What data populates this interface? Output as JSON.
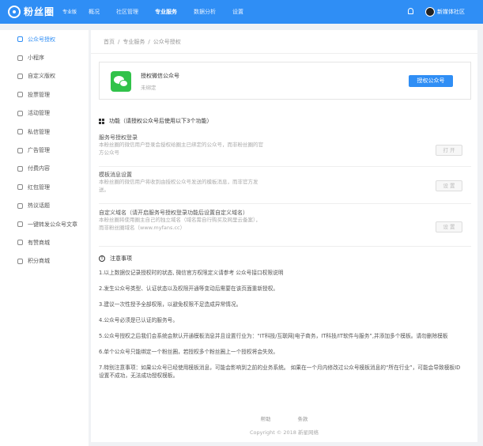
{
  "header": {
    "logo_text": "粉丝圈",
    "edition": "专业版",
    "nav": [
      "概况",
      "社区管理",
      "专业服务",
      "数据分析",
      "设置"
    ],
    "active_nav": 2,
    "user_name": "新媒体社区"
  },
  "sidebar": {
    "items": [
      {
        "label": "公众号授权",
        "icon": "wechat-icon",
        "active": true
      },
      {
        "label": "小程序",
        "icon": "mini-program-icon"
      },
      {
        "label": "自定义版权",
        "icon": "copyright-icon"
      },
      {
        "label": "投票管理",
        "icon": "vote-icon"
      },
      {
        "label": "活动管理",
        "icon": "flag-icon"
      },
      {
        "label": "私信管理",
        "icon": "message-icon"
      },
      {
        "label": "广告管理",
        "icon": "megaphone-icon"
      },
      {
        "label": "付费内容",
        "icon": "paid-icon"
      },
      {
        "label": "红包管理",
        "icon": "red-packet-icon"
      },
      {
        "label": "热议话题",
        "icon": "fire-icon"
      },
      {
        "label": "一键转发公众号文章",
        "icon": "link-icon"
      },
      {
        "label": "有赞商城",
        "icon": "shop-icon"
      },
      {
        "label": "积分商城",
        "icon": "points-icon"
      }
    ]
  },
  "breadcrumb": [
    "首页",
    "专业服务",
    "公众号授权"
  ],
  "card": {
    "title": "授权微信公众号",
    "status": "未绑定",
    "button": "授权公众号"
  },
  "features_heading": "功能（请授权公众号后使用以下3个功能）",
  "features": [
    {
      "title": "服务号授权登录",
      "desc": "本粉丝圈的微信用户登录会授权给圈主已绑定的公众号，而非粉丝圈的官方公众号",
      "button": "打 开"
    },
    {
      "title": "模板消息设置",
      "desc": "本粉丝圈的微信用户将收到由授权公众号发送的模板消息，而非官方发送。",
      "button": "设 置"
    },
    {
      "title": "自定义域名（请开启服务号授权登录功能后设置自定义域名）",
      "desc": "本粉丝圈将使用圈主自己的独立域名（域名需自行购买及网里云备案），而非粉丝圈域名（www.myfans.cc）",
      "button": "设 置"
    }
  ],
  "notice_heading": "注意事项",
  "notes": [
    "1.以上数据仅记录授权时的状态, 微信官方权限定义请参考 公众号接口权限说明",
    "2.发生公众号类型、认证状态以及权限开通等变动后需要在该页面重新授权。",
    "3.建议一次性授予全部权限，以避免权限不足造成异常情况。",
    "4.公众号必须是已认证的服务号。",
    "5.公众号授权之后我们会系统会默认开通模板消息并且设置行业为：“IT科技/互联网|电子商务，IT科技/IT软件与服务”,并添加多个模板。请勿删除模板",
    "6.单个公众号只能绑定一个粉丝圈，若授权多个粉丝圈上一个授权将会失效。",
    "7.特别注意事项：如果公众号已经使用模板消息，可能会影响到之前的业务系统。 如果在一个月内修改过公众号模板消息的“所在行业”，可能会导致模板ID设置不成功，无法成功授权模板。"
  ],
  "footer": {
    "links": [
      "帮助",
      "条款"
    ],
    "copyright": "Copyright © 2018 新星网络"
  },
  "colors": {
    "accent": "#2f8ef5",
    "wechat_green": "#31c24a"
  }
}
